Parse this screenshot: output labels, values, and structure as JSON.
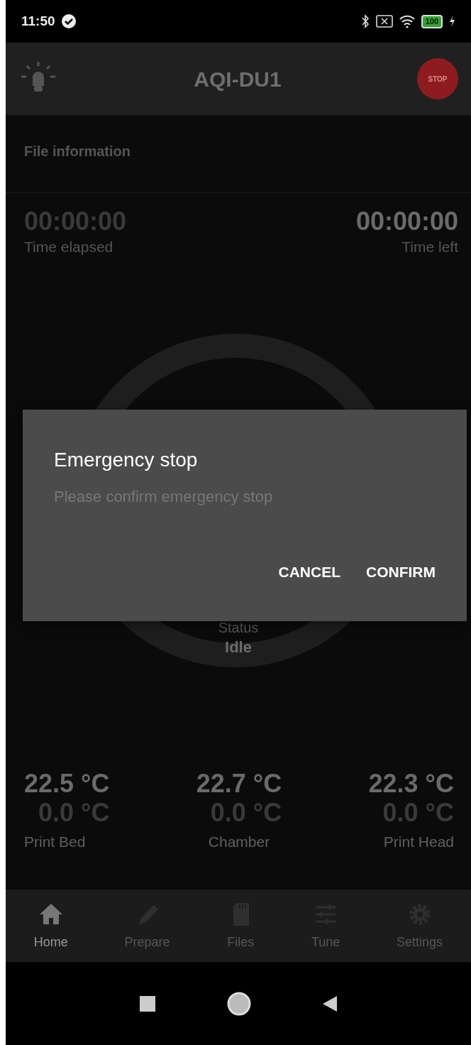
{
  "status_bar": {
    "time": "11:50",
    "battery": "100"
  },
  "app_bar": {
    "title": "AQI-DU1",
    "stop_label": "STOP"
  },
  "file_info": {
    "title": "File information"
  },
  "timers": [
    {
      "value": "00:00:00",
      "label": "Time elapsed"
    },
    {
      "value": "00:00:00",
      "label": "Time left"
    }
  ],
  "progress": {
    "status_label": "Status",
    "status": "Idle"
  },
  "temperatures": [
    {
      "current": "22.5 °C",
      "target": "0.0 °C",
      "label": "Print Bed"
    },
    {
      "current": "22.7 °C",
      "target": "0.0 °C",
      "label": "Chamber"
    },
    {
      "current": "22.3 °C",
      "target": "0.0 °C",
      "label": "Print Head"
    }
  ],
  "bottom_nav": [
    {
      "kind": "home",
      "label": "Home",
      "selected": true
    },
    {
      "kind": "prepare",
      "label": "Prepare",
      "selected": false
    },
    {
      "kind": "files",
      "label": "Files",
      "selected": false
    },
    {
      "kind": "tune",
      "label": "Tune",
      "selected": false
    },
    {
      "kind": "settings",
      "label": "Settings",
      "selected": false
    }
  ],
  "dialog": {
    "title": "Emergency stop",
    "message": "Please confirm emergency stop",
    "buttons": [
      "CANCEL",
      "CONFIRM"
    ]
  }
}
